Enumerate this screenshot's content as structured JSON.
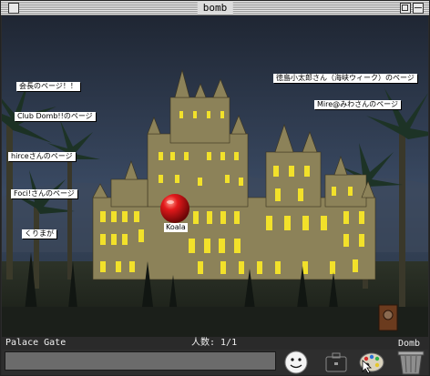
{
  "window": {
    "title": "bomb"
  },
  "links": [
    {
      "label": "会長のページ！！"
    },
    {
      "label": "Club Domb!!のページ"
    },
    {
      "label": "hirceさんのページ"
    },
    {
      "label": "Foci!さんのページ"
    },
    {
      "label": "くりまが"
    },
    {
      "label": "徳島小太郎さん（海峡ウィーク）のページ"
    },
    {
      "label": "Mire@みわさんのページ"
    }
  ],
  "avatar": {
    "name": "Koala"
  },
  "status": {
    "place": "Palace Gate",
    "population": "人数: 1/1"
  },
  "chat": {
    "value": ""
  },
  "toolbar": {
    "trash_label": "Domb"
  },
  "icons": [
    "smiley-icon",
    "briefcase-icon",
    "palette-icon",
    "trash-icon",
    "mouse-cursor-icon",
    "door-icon"
  ],
  "colors": {
    "sky": "#2f3b4e",
    "window_glow": "#f2e12a",
    "avatar": "#e3191b"
  }
}
